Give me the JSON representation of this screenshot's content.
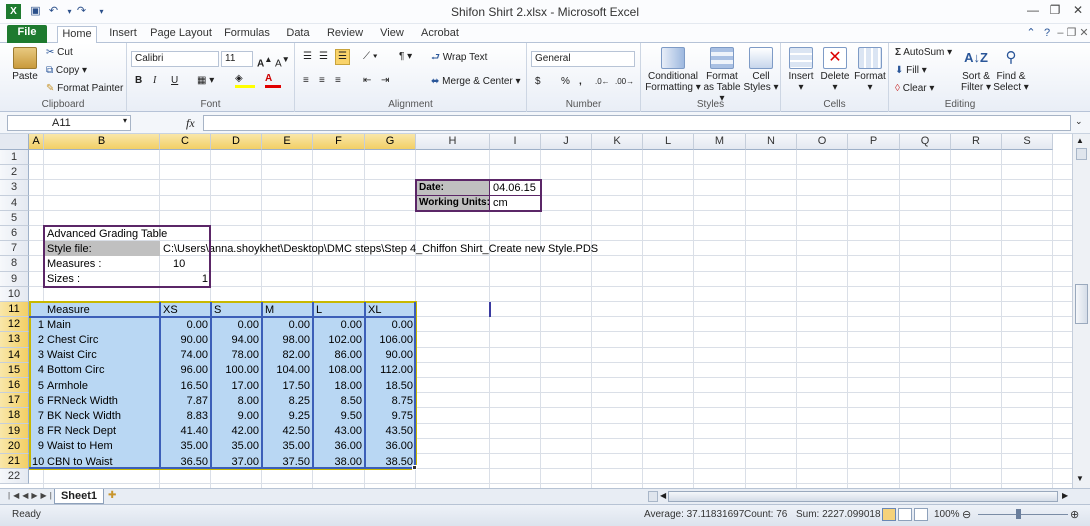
{
  "window": {
    "title": "Shifon Shirt 2.xlsx - Microsoft Excel",
    "minimize_glyph": "—",
    "restore_glyph": "❐",
    "close_glyph": "✕"
  },
  "tabs": [
    "File",
    "Home",
    "Insert",
    "Page Layout",
    "Formulas",
    "Data",
    "Review",
    "View",
    "Acrobat"
  ],
  "ribbon": {
    "clipboard": {
      "paste": "Paste",
      "cut": "Cut",
      "copy": "Copy",
      "format_painter": "Format Painter",
      "label": "Clipboard"
    },
    "font": {
      "name": "Calibri",
      "size": "11",
      "bold": "B",
      "italic": "I",
      "underline": "U",
      "label": "Font"
    },
    "alignment": {
      "wrap_text": "Wrap Text",
      "merge_center": "Merge & Center",
      "label": "Alignment"
    },
    "number": {
      "format": "General",
      "currency": "$",
      "percent": "%",
      "comma": ",",
      "label": "Number"
    },
    "styles": {
      "conditional_1": "Conditional",
      "conditional_2": "Formatting",
      "format_table_1": "Format",
      "format_table_2": "as Table",
      "cell_styles_1": "Cell",
      "cell_styles_2": "Styles",
      "label": "Styles"
    },
    "cells": {
      "insert": "Insert",
      "delete": "Delete",
      "format": "Format",
      "label": "Cells"
    },
    "editing": {
      "autosum": "AutoSum",
      "fill": "Fill",
      "clear": "Clear",
      "sort_1": "Sort &",
      "sort_2": "Filter",
      "find_1": "Find &",
      "find_2": "Select",
      "label": "Editing"
    }
  },
  "formula_bar": {
    "name_box": "A11",
    "fx": "fx",
    "formula": ""
  },
  "columns": [
    "A",
    "B",
    "C",
    "D",
    "E",
    "F",
    "G",
    "H",
    "I",
    "J",
    "K",
    "L",
    "M",
    "N",
    "O",
    "P",
    "Q",
    "R",
    "S"
  ],
  "rows": [
    "1",
    "2",
    "3",
    "4",
    "5",
    "6",
    "7",
    "8",
    "9",
    "10",
    "11",
    "12",
    "13",
    "14",
    "15",
    "16",
    "17",
    "18",
    "19",
    "20",
    "21",
    "22"
  ],
  "cells": {
    "date_label": "Date:",
    "date_value": "04.06.15",
    "units_label": "Working Units:",
    "units_value": "cm",
    "grading_title": "Advanced Grading Table",
    "style_file_label": "Style file:",
    "style_file_path": "C:\\Users\\anna.shoykhet\\Desktop\\DMC steps\\Step 4_Chiffon Shirt_Create new Style.PDS",
    "measures_label": "Measures :",
    "measures_value": "10",
    "sizes_label": "Sizes :",
    "sizes_value": "1"
  },
  "table": {
    "header": [
      "Measure",
      "XS",
      "S",
      "M",
      "L",
      "XL"
    ],
    "rows": [
      [
        "1",
        "Main",
        "0.00",
        "0.00",
        "0.00",
        "0.00",
        "0.00"
      ],
      [
        "2",
        "Chest Circ",
        "90.00",
        "94.00",
        "98.00",
        "102.00",
        "106.00"
      ],
      [
        "3",
        "Waist Circ",
        "74.00",
        "78.00",
        "82.00",
        "86.00",
        "90.00"
      ],
      [
        "4",
        "Bottom Circ",
        "96.00",
        "100.00",
        "104.00",
        "108.00",
        "112.00"
      ],
      [
        "5",
        "Armhole",
        "16.50",
        "17.00",
        "17.50",
        "18.00",
        "18.50"
      ],
      [
        "6",
        "FRNeck Width",
        "7.87",
        "8.00",
        "8.25",
        "8.50",
        "8.75"
      ],
      [
        "7",
        "BK Neck Width",
        "8.83",
        "9.00",
        "9.25",
        "9.50",
        "9.75"
      ],
      [
        "8",
        "FR Neck Dept",
        "41.40",
        "42.00",
        "42.50",
        "43.00",
        "43.50"
      ],
      [
        "9",
        "Waist to Hem",
        "35.00",
        "35.00",
        "35.00",
        "36.00",
        "36.00"
      ],
      [
        "10",
        "CBN to Waist",
        "36.50",
        "37.00",
        "37.50",
        "38.00",
        "38.50"
      ]
    ]
  },
  "sheet_tab": "Sheet1",
  "status": {
    "ready": "Ready",
    "average": "Average: 37.11831697",
    "count": "Count: 76",
    "sum": "Sum: 2227.099018",
    "zoom": "100%"
  },
  "colors": {
    "file_tab": "#1e7a2f",
    "selection": "#b9d7f3",
    "purple_border": "#5b2667",
    "blue_border": "#3c5fb8",
    "gold_border": "#c8b800"
  }
}
